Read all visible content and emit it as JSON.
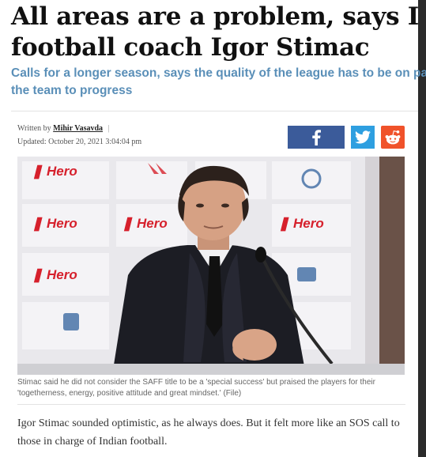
{
  "article": {
    "headline_line1": "All areas are a problem, says I",
    "headline_line2": "football coach Igor Stimac",
    "subhead_line1": "Calls for a longer season, says the quality of the league has to be on par",
    "subhead_line2": "the team to progress",
    "byline_prefix": "Written by",
    "author": "Mihir Vasavda",
    "byline_sep": "|",
    "updated": "Updated: October 20, 2021 3:04:04 pm",
    "caption": "Stimac said he did not consider the SAFF title to be a 'special success' but praised the players for their 'togetherness, energy, positive attitude and great mindset.' (File)",
    "body_paragraph": "Igor Stimac sounded optimistic, as he always does. But it felt more like an SOS call to those in charge of Indian football."
  },
  "photo": {
    "sponsor_text": "Hero",
    "backdrop_color": "#e9e8ec",
    "sponsor_color": "#d6202c"
  },
  "share": {
    "icons": [
      "facebook-icon",
      "twitter-icon",
      "reddit-icon"
    ],
    "facebook_color": "#3b5b9a",
    "twitter_color": "#2e9fe0",
    "reddit_color": "#f0522a"
  }
}
